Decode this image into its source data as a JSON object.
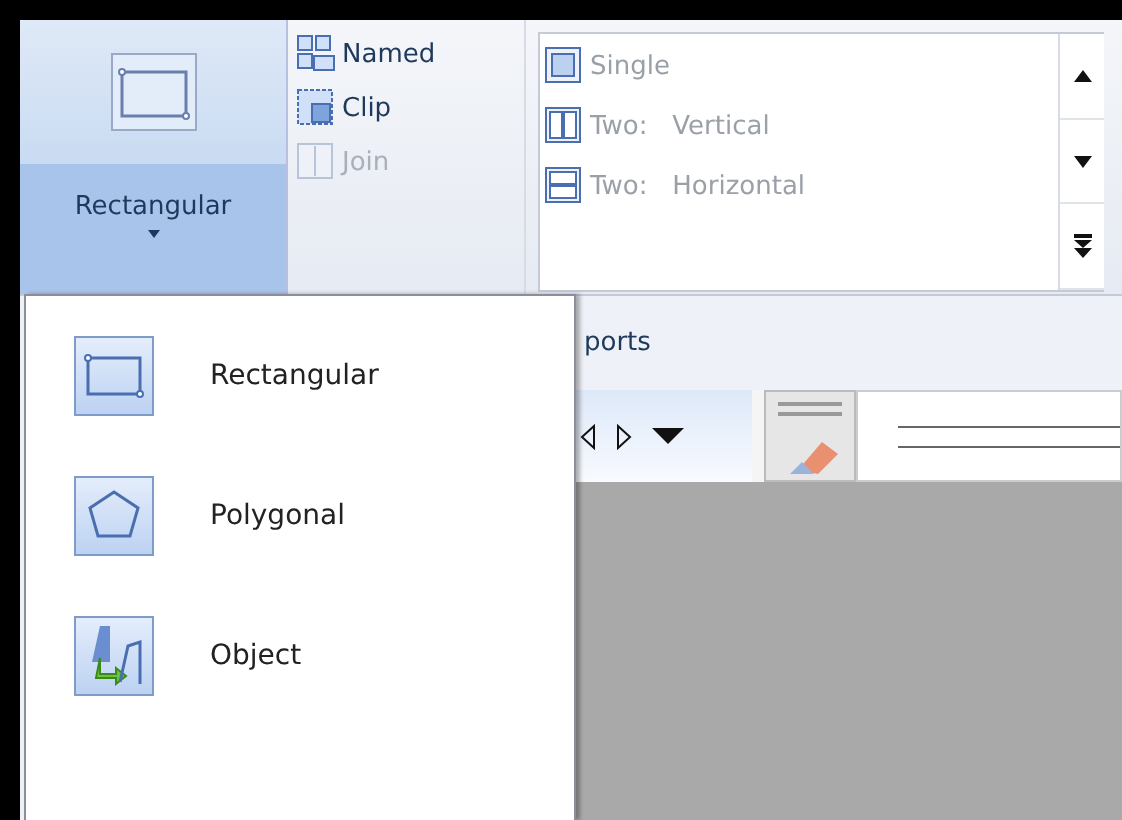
{
  "ribbon": {
    "shape_button": {
      "label": "Rectangular",
      "expanded": true
    },
    "small_buttons": [
      {
        "label": "Named",
        "kind": "named",
        "disabled": false
      },
      {
        "label": "Clip",
        "kind": "clip",
        "disabled": false
      },
      {
        "label": "Join",
        "kind": "join",
        "disabled": true
      }
    ],
    "gallery": {
      "items": [
        {
          "label": "Single",
          "kind": "single",
          "disabled": true
        },
        {
          "label": "Two:   Vertical",
          "kind": "vertical",
          "disabled": true
        },
        {
          "label": "Two:   Horizontal",
          "kind": "horizontal",
          "disabled": true
        }
      ]
    }
  },
  "background": {
    "tab_label": "ports"
  },
  "dropdown_menu": {
    "items": [
      {
        "label": "Rectangular",
        "kind": "rectangular"
      },
      {
        "label": "Polygonal",
        "kind": "polygonal"
      },
      {
        "label": "Object",
        "kind": "object"
      }
    ]
  }
}
